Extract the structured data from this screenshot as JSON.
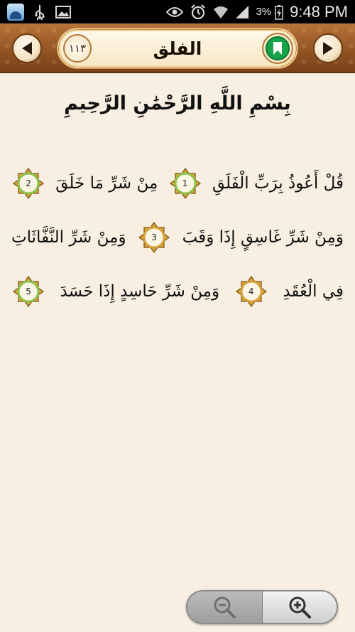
{
  "status_bar": {
    "time": "9:48 PM",
    "battery_percent": "3%",
    "icons": [
      "app-icon",
      "usb-icon",
      "image-icon",
      "eye-icon",
      "alarm-icon",
      "wifi-icon",
      "signal-icon",
      "battery-charging-icon"
    ]
  },
  "header": {
    "surah_number": "١١٣",
    "surah_title": "الفلق",
    "prev_icon": "triangle-left-icon",
    "next_icon": "triangle-right-icon",
    "bookmark_icon": "bookmark-icon"
  },
  "basmala": "بِسْمِ اللَّهِ الرَّحْمَٰنِ الرَّحِيمِ",
  "verses": {
    "line1": {
      "a": "قُلْ أَعُوذُ بِرَبِّ الْفَلَقِ",
      "m1": "1",
      "b": "مِنْ شَرِّ مَا خَلَقَ",
      "m2": "2"
    },
    "line2": {
      "a": "وَمِنْ شَرِّ غَاسِقٍ إِذَا وَقَبَ",
      "m3": "3",
      "b": "وَمِنْ شَرِّ النَّفَّاثَاتِ"
    },
    "line3": {
      "a": "فِي الْعُقَدِ",
      "m4": "4",
      "b": "وَمِنْ شَرِّ حَاسِدٍ إِذَا حَسَدَ",
      "m5": "5"
    }
  },
  "zoom": {
    "out_icon": "zoom-out-icon",
    "in_icon": "zoom-in-icon"
  },
  "colors": {
    "background": "#f8efe2",
    "header_brown": "#8f5222",
    "bookmark_green": "#15a44a",
    "verse_marker_gold": "#d6a23a",
    "verse_marker_green": "#8bc34a"
  }
}
